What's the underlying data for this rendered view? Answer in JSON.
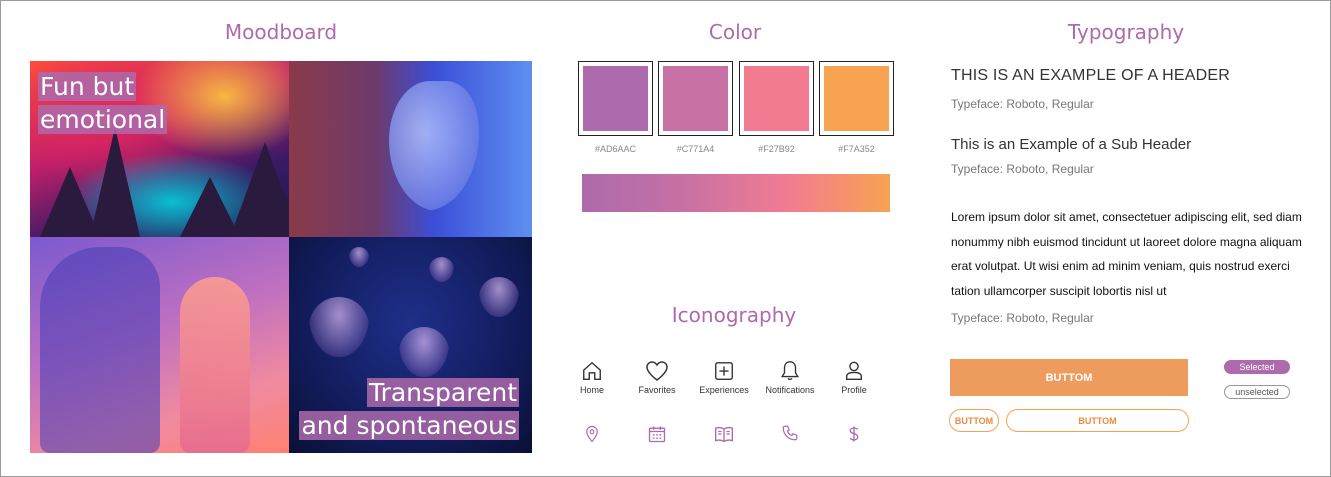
{
  "sections": {
    "moodboard": "Moodboard",
    "color": "Color",
    "typography": "Typography",
    "iconography": "Iconography"
  },
  "moodboard": {
    "caption_1_line_1": "Fun but",
    "caption_1_line_2": "emotional",
    "caption_2_line_1": "Transparent",
    "caption_2_line_2": "and spontaneous"
  },
  "colors": {
    "swatches": [
      {
        "hex": "#AD6AAC"
      },
      {
        "hex": "#C771A4"
      },
      {
        "hex": "#F27B92"
      },
      {
        "hex": "#F7A352"
      }
    ]
  },
  "iconography": {
    "labeled": [
      {
        "icon": "home-icon",
        "label": "Home"
      },
      {
        "icon": "heart-icon",
        "label": "Favorites"
      },
      {
        "icon": "plus-square-icon",
        "label": "Experiences"
      },
      {
        "icon": "bell-icon",
        "label": "Notifications"
      },
      {
        "icon": "user-icon",
        "label": "Profile"
      }
    ],
    "unlabeled": [
      "location-pin-icon",
      "calendar-icon",
      "book-icon",
      "phone-icon",
      "dollar-icon"
    ],
    "accent": "#AD6AAC"
  },
  "typography": {
    "header": "THIS IS AN EXAMPLE OF A HEADER",
    "header_face": "Typeface: Roboto, Regular",
    "sub_header": "This is an Example of a Sub Header",
    "sub_header_face": "Typeface: Roboto, Regular",
    "body": "Lorem ipsum dolor sit amet, consectetuer adipiscing elit, sed diam nonummy nibh euismod tincidunt ut laoreet dolore magna aliquam erat volutpat. Ut wisi enim ad minim veniam, quis nostrud exerci tation ullamcorper suscipit lobortis nisl ut",
    "body_face": "Typeface: Roboto, Regular"
  },
  "buttons": {
    "primary_label": "BUTTOM",
    "small_outline_label": "BUTTOM",
    "wide_outline_label": "BUTTOM",
    "chip_selected": "Selected",
    "chip_unselected": "unselected"
  }
}
